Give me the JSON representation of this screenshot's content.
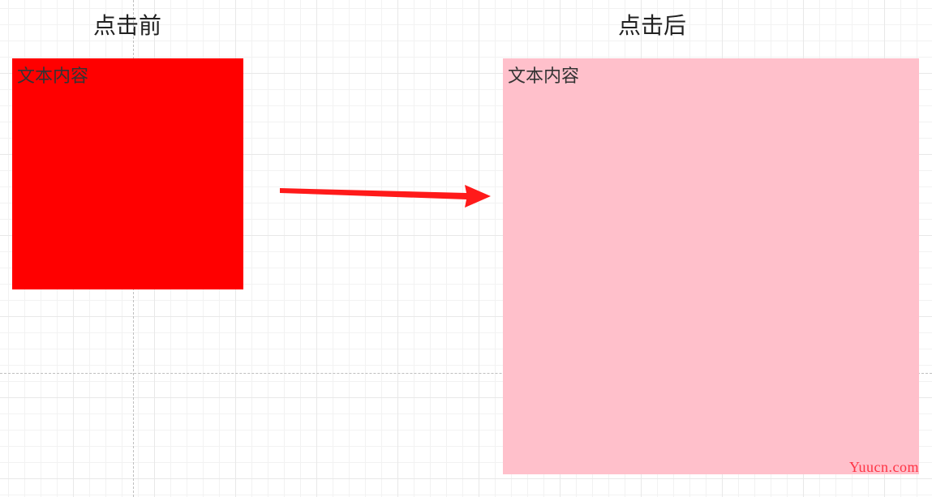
{
  "labels": {
    "before": "点击前",
    "after": "点击后"
  },
  "boxes": {
    "before_text": "文本内容",
    "after_text": "文本内容",
    "before_color": "#ff0000",
    "after_color": "#ffc0cb"
  },
  "watermark": "Yuucn.com"
}
